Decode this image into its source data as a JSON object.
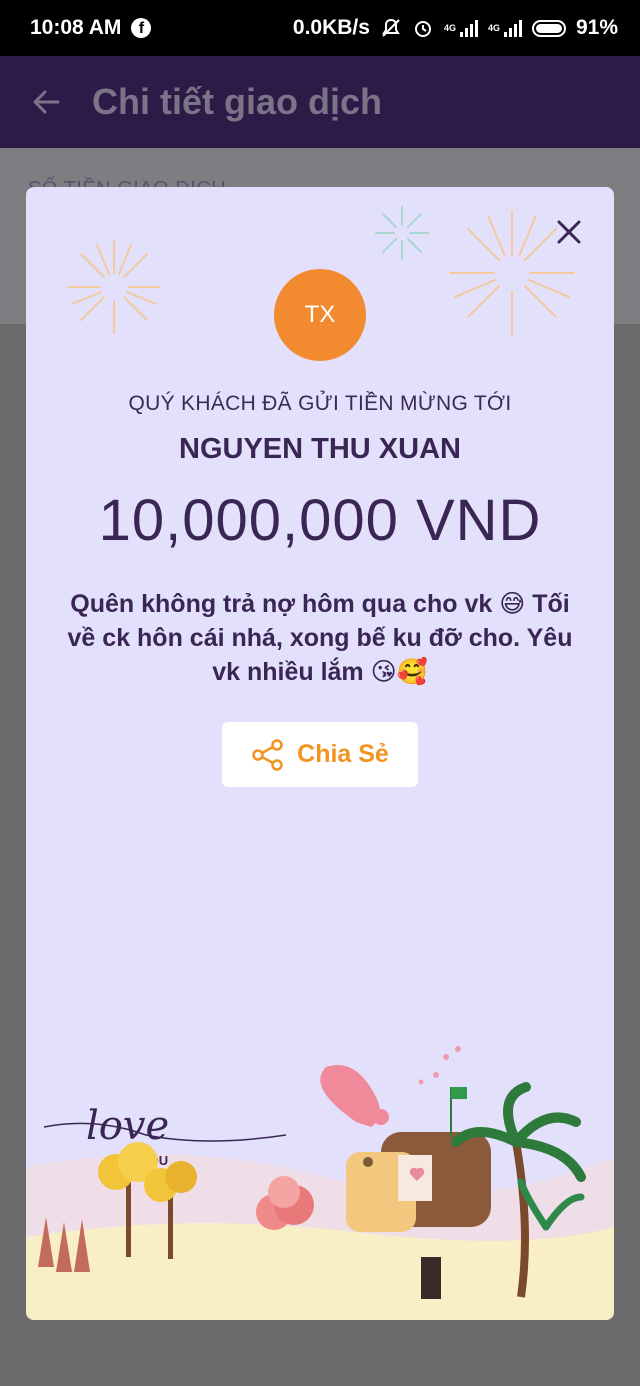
{
  "status_bar": {
    "time": "10:08 AM",
    "network_speed": "0.0KB/s",
    "network_type_1": "4G",
    "network_type_2": "4G",
    "battery": "91%"
  },
  "app_bar": {
    "title": "Chi tiết giao dịch"
  },
  "background_section": {
    "label": "SỐ TIỀN GIAO DỊCH"
  },
  "modal": {
    "avatar_initials": "TX",
    "sent_label": "QUÝ KHÁCH ĐÃ GỬI TIỀN MỪNG TỚI",
    "recipient_name": "NGUYEN THU XUAN",
    "amount": "10,000,000 VND",
    "message": "Quên không trả nợ hôm qua cho vk 😅 Tối về ck hôn cái nhá, xong bế ku đỡ cho. Yêu vk nhiều lắm 😘🥰",
    "share_label": "Chia Sẻ",
    "illustration_text_1": "love",
    "illustration_text_2": "YOU"
  },
  "colors": {
    "card_bg": "#e3e0fb",
    "avatar_bg": "#f28a30",
    "accent_orange": "#f39422",
    "text_purple": "#3a2655",
    "app_bar_bg": "#2d1a47"
  }
}
